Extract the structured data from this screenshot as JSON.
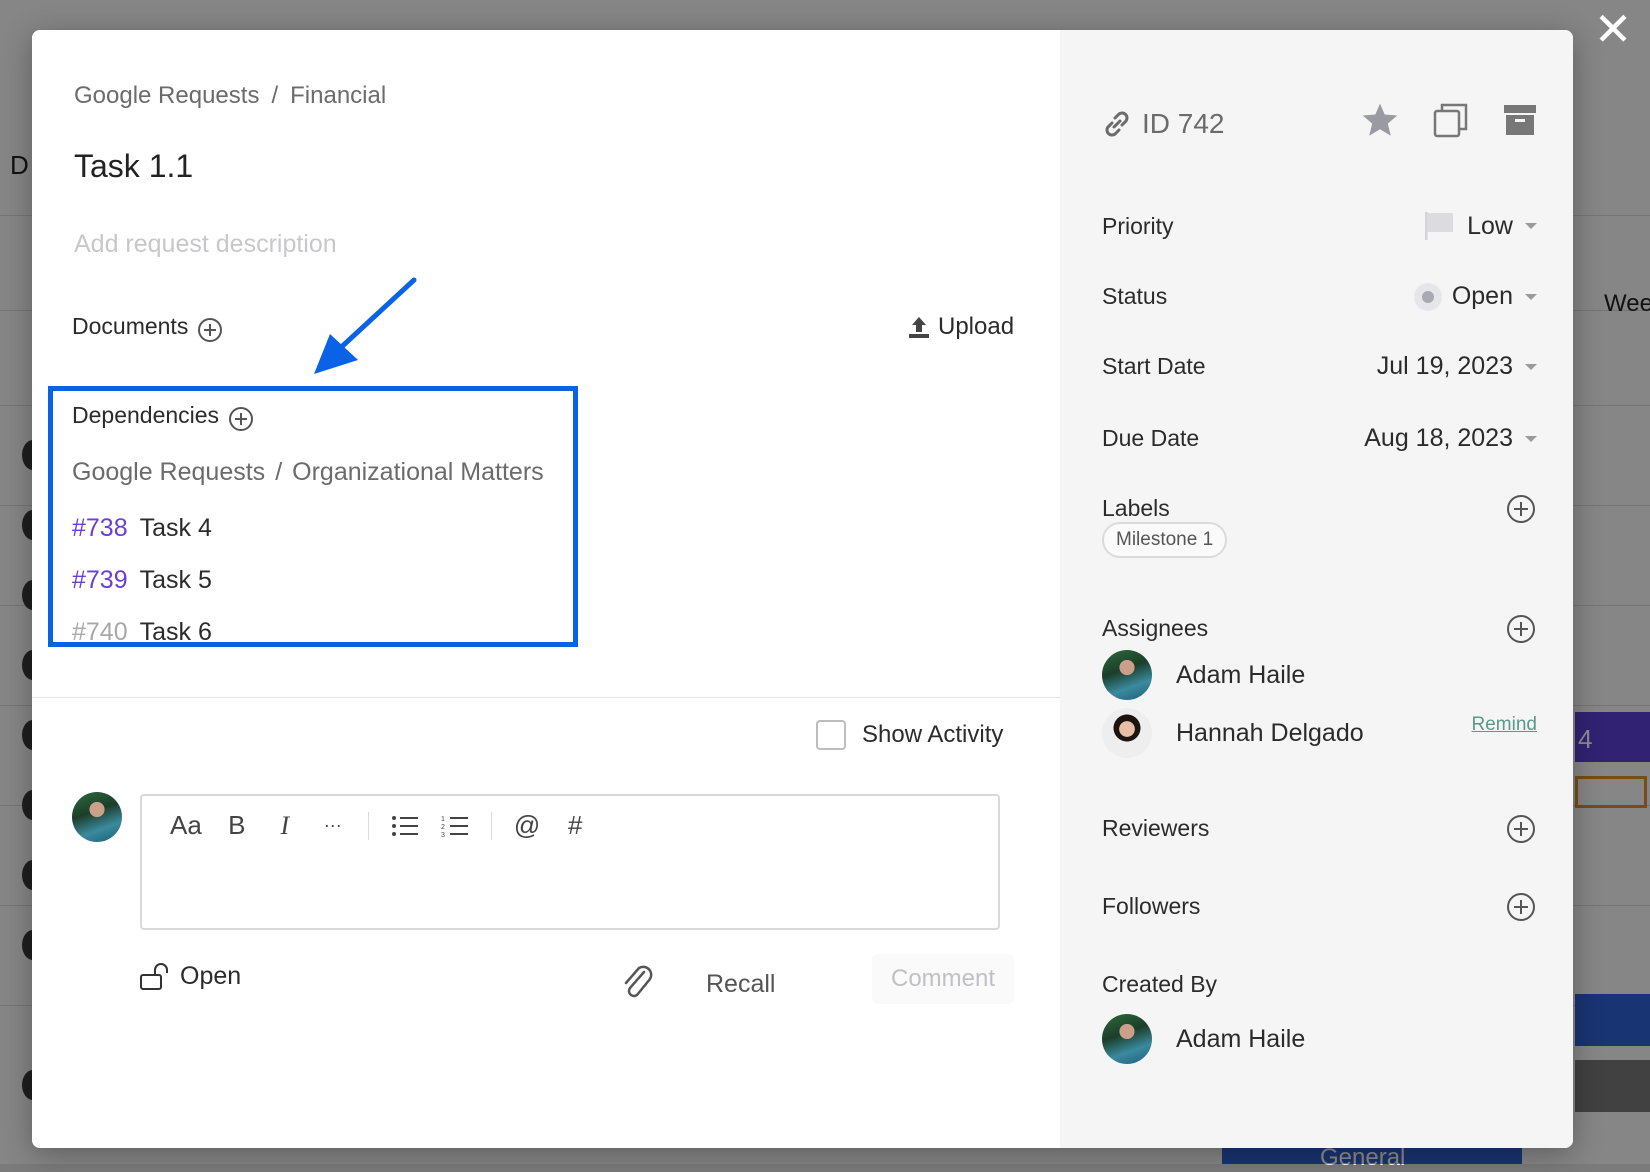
{
  "breadcrumb": {
    "parent": "Google Requests",
    "separator": "/",
    "current": "Financial"
  },
  "task": {
    "title": "Task 1.1",
    "description_placeholder": "Add request description"
  },
  "documents": {
    "label": "Documents",
    "upload_label": "Upload"
  },
  "dependencies": {
    "label": "Dependencies",
    "path": {
      "parent": "Google Requests",
      "separator": "/",
      "current": "Organizational Matters"
    },
    "items": [
      {
        "id": "#738",
        "name": "Task 4"
      },
      {
        "id": "#739",
        "name": "Task 5"
      },
      {
        "id": "#740",
        "name": "Task 6"
      }
    ]
  },
  "activity": {
    "show_label": "Show Activity",
    "checked": false
  },
  "editor": {
    "tools": [
      "Aa",
      "B",
      "I",
      "···",
      "bulleted-list",
      "numbered-list",
      "@",
      "#"
    ]
  },
  "footer": {
    "open_label": "Open",
    "recall_label": "Recall",
    "comment_label": "Comment"
  },
  "sidebar": {
    "id_label": "ID 742",
    "priority": {
      "label": "Priority",
      "value": "Low"
    },
    "status": {
      "label": "Status",
      "value": "Open"
    },
    "start_date": {
      "label": "Start Date",
      "value": "Jul 19, 2023"
    },
    "due_date": {
      "label": "Due Date",
      "value": "Aug 18, 2023"
    },
    "labels": {
      "label": "Labels",
      "items": [
        "Milestone 1"
      ]
    },
    "assignees": {
      "label": "Assignees",
      "people": [
        {
          "name": "Adam Haile"
        },
        {
          "name": "Hannah Delgado",
          "action": "Remind"
        }
      ]
    },
    "reviewers": {
      "label": "Reviewers"
    },
    "followers": {
      "label": "Followers"
    },
    "created_by": {
      "label": "Created By",
      "name": "Adam Haile"
    }
  },
  "background": {
    "letter": "D",
    "week_label": "Wee",
    "task_number": "4",
    "group_label": "General"
  },
  "colors": {
    "highlight_border": "#0a62e6",
    "dependency_id": "#6a3fd6",
    "remind_link": "#5a9a86"
  },
  "icons": {
    "close": "close-icon",
    "link": "link-icon",
    "star": "star-icon",
    "copy": "copy-icon",
    "archive": "archive-icon",
    "flag": "flag-icon",
    "unlock": "unlock-icon",
    "paperclip": "paperclip-icon"
  }
}
